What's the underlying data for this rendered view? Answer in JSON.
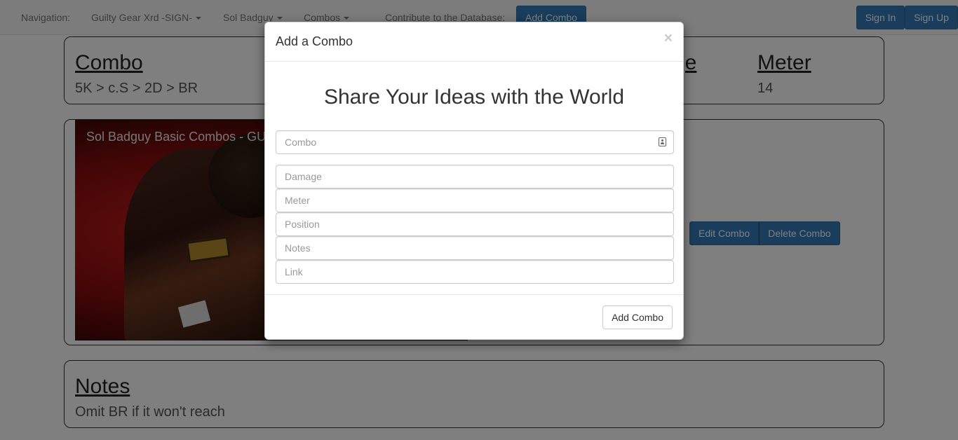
{
  "navbar": {
    "label": "Navigation:",
    "game": "Guilty Gear Xrd -SIGN-",
    "character": "Sol Badguy",
    "combos": "Combos",
    "contribute": "Contribute to the Database:",
    "add_combo": "Add Combo",
    "sign_in": "Sign In",
    "sign_up": "Sign Up"
  },
  "combo_panel": {
    "combo_heading": "Combo",
    "combo_value": "5K > c.S > 2D > BR",
    "damage_heading_partial": "ge",
    "meter_heading": "Meter",
    "meter_value": "14"
  },
  "video": {
    "title": "Sol Badguy Basic Combos - GUI"
  },
  "actions": {
    "edit": "Edit Combo",
    "delete": "Delete Combo"
  },
  "notes_panel": {
    "heading": "Notes",
    "value": "Omit BR if it won't reach"
  },
  "modal": {
    "title": "Add a Combo",
    "close": "×",
    "heading": "Share Your Ideas with the World",
    "fields": {
      "combo": "Combo",
      "damage": "Damage",
      "meter": "Meter",
      "position": "Position",
      "notes": "Notes",
      "link": "Link"
    },
    "submit": "Add Combo"
  },
  "colors": {
    "primary": "#337ab7",
    "navbar_bg": "#f8f8f8",
    "backdrop": "rgba(0,0,0,0.5)"
  }
}
